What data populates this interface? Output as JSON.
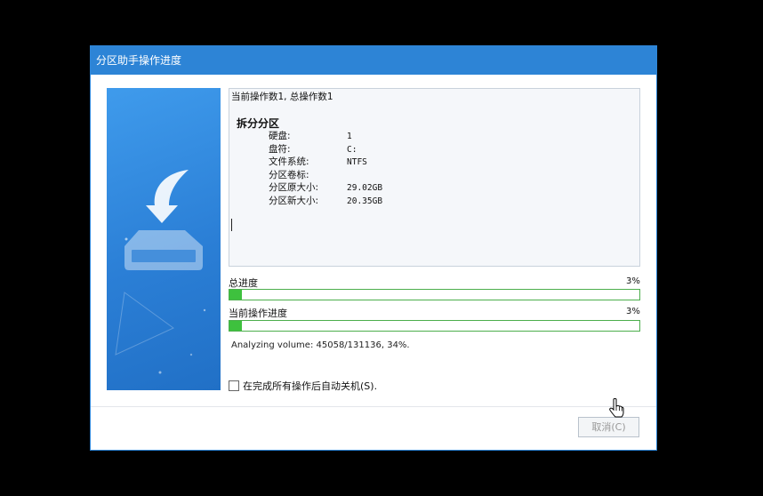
{
  "window": {
    "title": "分区助手操作进度"
  },
  "log": {
    "header": "当前操作数1, 总操作数1",
    "operation": "拆分分区",
    "details": [
      {
        "key": "硬盘:",
        "value": "1"
      },
      {
        "key": "盘符:",
        "value": "C:"
      },
      {
        "key": "文件系统:",
        "value": "NTFS"
      },
      {
        "key": "分区卷标:",
        "value": ""
      },
      {
        "key": "分区原大小:",
        "value": "29.02GB"
      },
      {
        "key": "分区新大小:",
        "value": "20.35GB"
      }
    ]
  },
  "progress": {
    "total_label": "总进度",
    "total_percent_text": "3%",
    "total_value": 0.03,
    "current_label": "当前操作进度",
    "current_percent_text": "3%",
    "current_value": 0.03,
    "fill_color": "#3ec13e"
  },
  "status": "Analyzing volume: 45058/131136, 34%.",
  "shutdown_option": {
    "label": "在完成所有操作后自动关机(S).",
    "checked": false
  },
  "buttons": {
    "cancel_label": "取消(C)"
  },
  "icons": {
    "side": "download-drive-icon",
    "pointer": "hand-cursor-icon"
  }
}
